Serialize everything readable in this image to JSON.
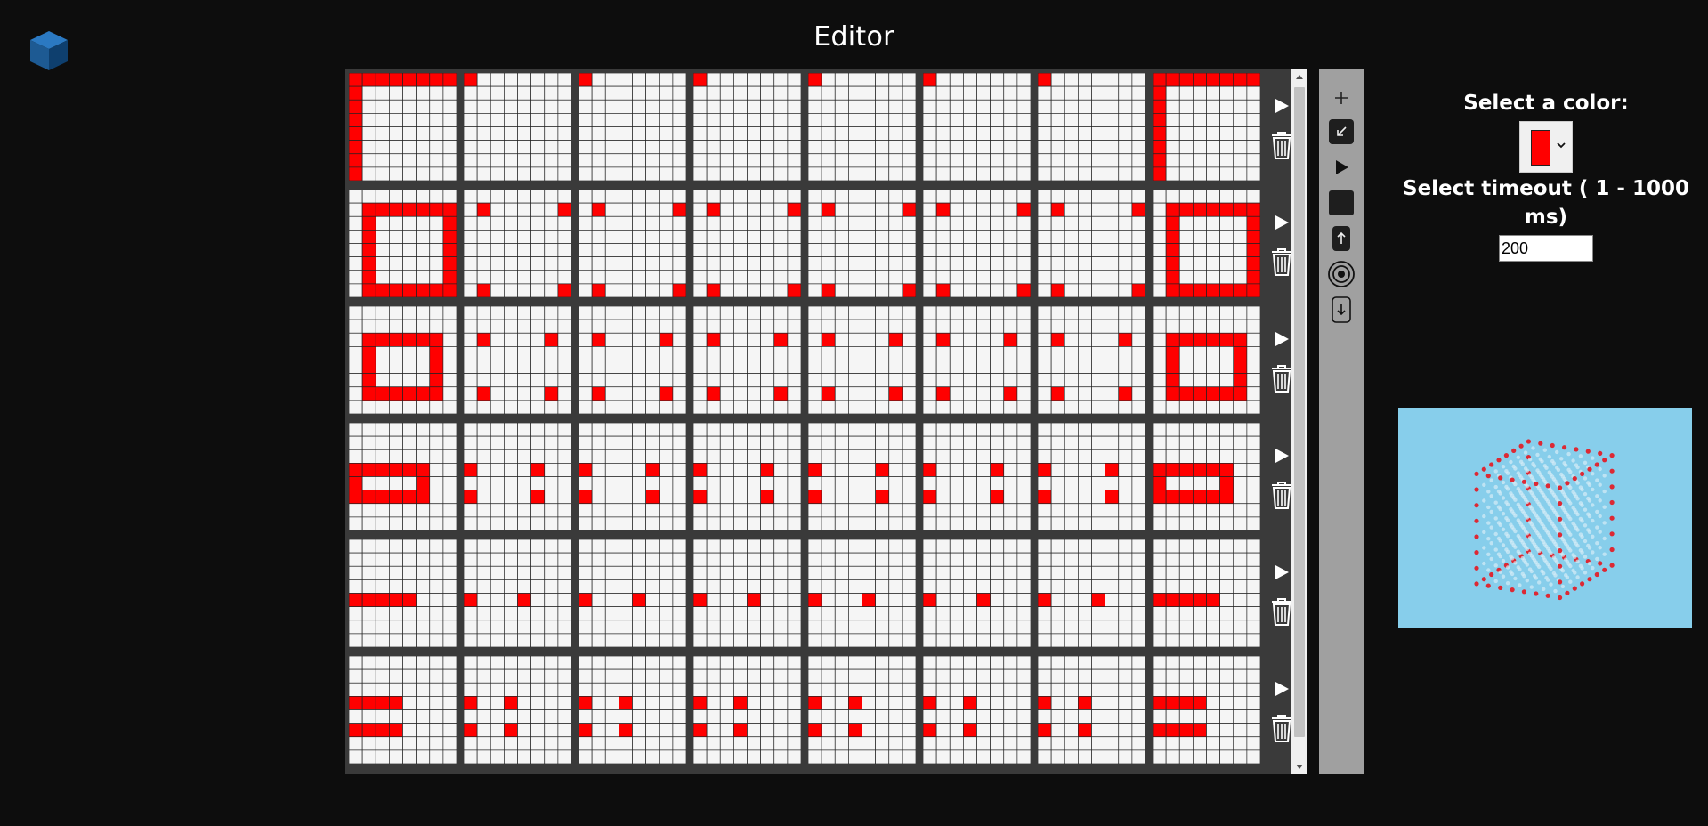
{
  "app": {
    "title": "Editor",
    "logo_icon": "cube-icon"
  },
  "colors": {
    "background": "#0d0d0d",
    "panel": "#3a3a3a",
    "toolbar": "#a0a0a0",
    "cell_on": "#ff0000",
    "cell_off": "#f5f5f5",
    "preview_bg": "#87ceeb"
  },
  "frames": {
    "rows": [
      {
        "layers": [
          "ring:0,0,8",
          "corners:0,0,8",
          "corners:0,0,8",
          "corners:0,0,8",
          "corners:0,0,8",
          "corners:0,0,8",
          "corners:0,0,8",
          "ring:0,0,8"
        ]
      },
      {
        "layers": [
          "ring:1,1,7",
          "corners:1,1,7",
          "corners:1,1,7",
          "corners:1,1,7",
          "corners:1,1,7",
          "corners:1,1,7",
          "corners:1,1,7",
          "ring:1,1,7"
        ]
      },
      {
        "layers": [
          "ring:2,1,6",
          "corners:2,1,6",
          "corners:2,1,6",
          "corners:2,1,6",
          "corners:2,1,6",
          "corners:2,1,6",
          "corners:2,1,6",
          "ring:2,1,6"
        ]
      },
      {
        "layers": [
          "ring:3,0,5",
          "corners:3,0,5",
          "corners:3,0,5",
          "corners:3,0,5",
          "corners:3,0,5",
          "corners:3,0,5",
          "corners:3,0,5",
          "ring:3,0,5"
        ]
      },
      {
        "layers": [
          "ring:4,0,4",
          "corners:4,0,4",
          "corners:4,0,4",
          "corners:4,0,4",
          "corners:4,0,4",
          "corners:4,0,4",
          "corners:4,0,4",
          "ring:4,0,4"
        ]
      },
      {
        "layers": [
          "ring:5,0,3",
          "corners:5,0,3",
          "corners:5,0,3",
          "corners:5,0,3",
          "corners:5,0,3",
          "corners:5,0,3",
          "corners:5,0,3",
          "ring:5,0,3"
        ]
      }
    ]
  },
  "row_actions": {
    "play_icon": "play-icon",
    "delete_icon": "trash-icon"
  },
  "toolbar": {
    "icons": [
      "plus-icon",
      "collapse-icon",
      "play-icon",
      "stop-icon",
      "upload-icon",
      "record-icon",
      "download-icon"
    ]
  },
  "sidebar": {
    "color_label": "Select a color:",
    "selected_color": "#ff0000",
    "timeout_label": "Select timeout ( 1 - 1000 ms)",
    "timeout_value": "200"
  },
  "preview": {
    "description_icon": "led-cube-preview"
  }
}
